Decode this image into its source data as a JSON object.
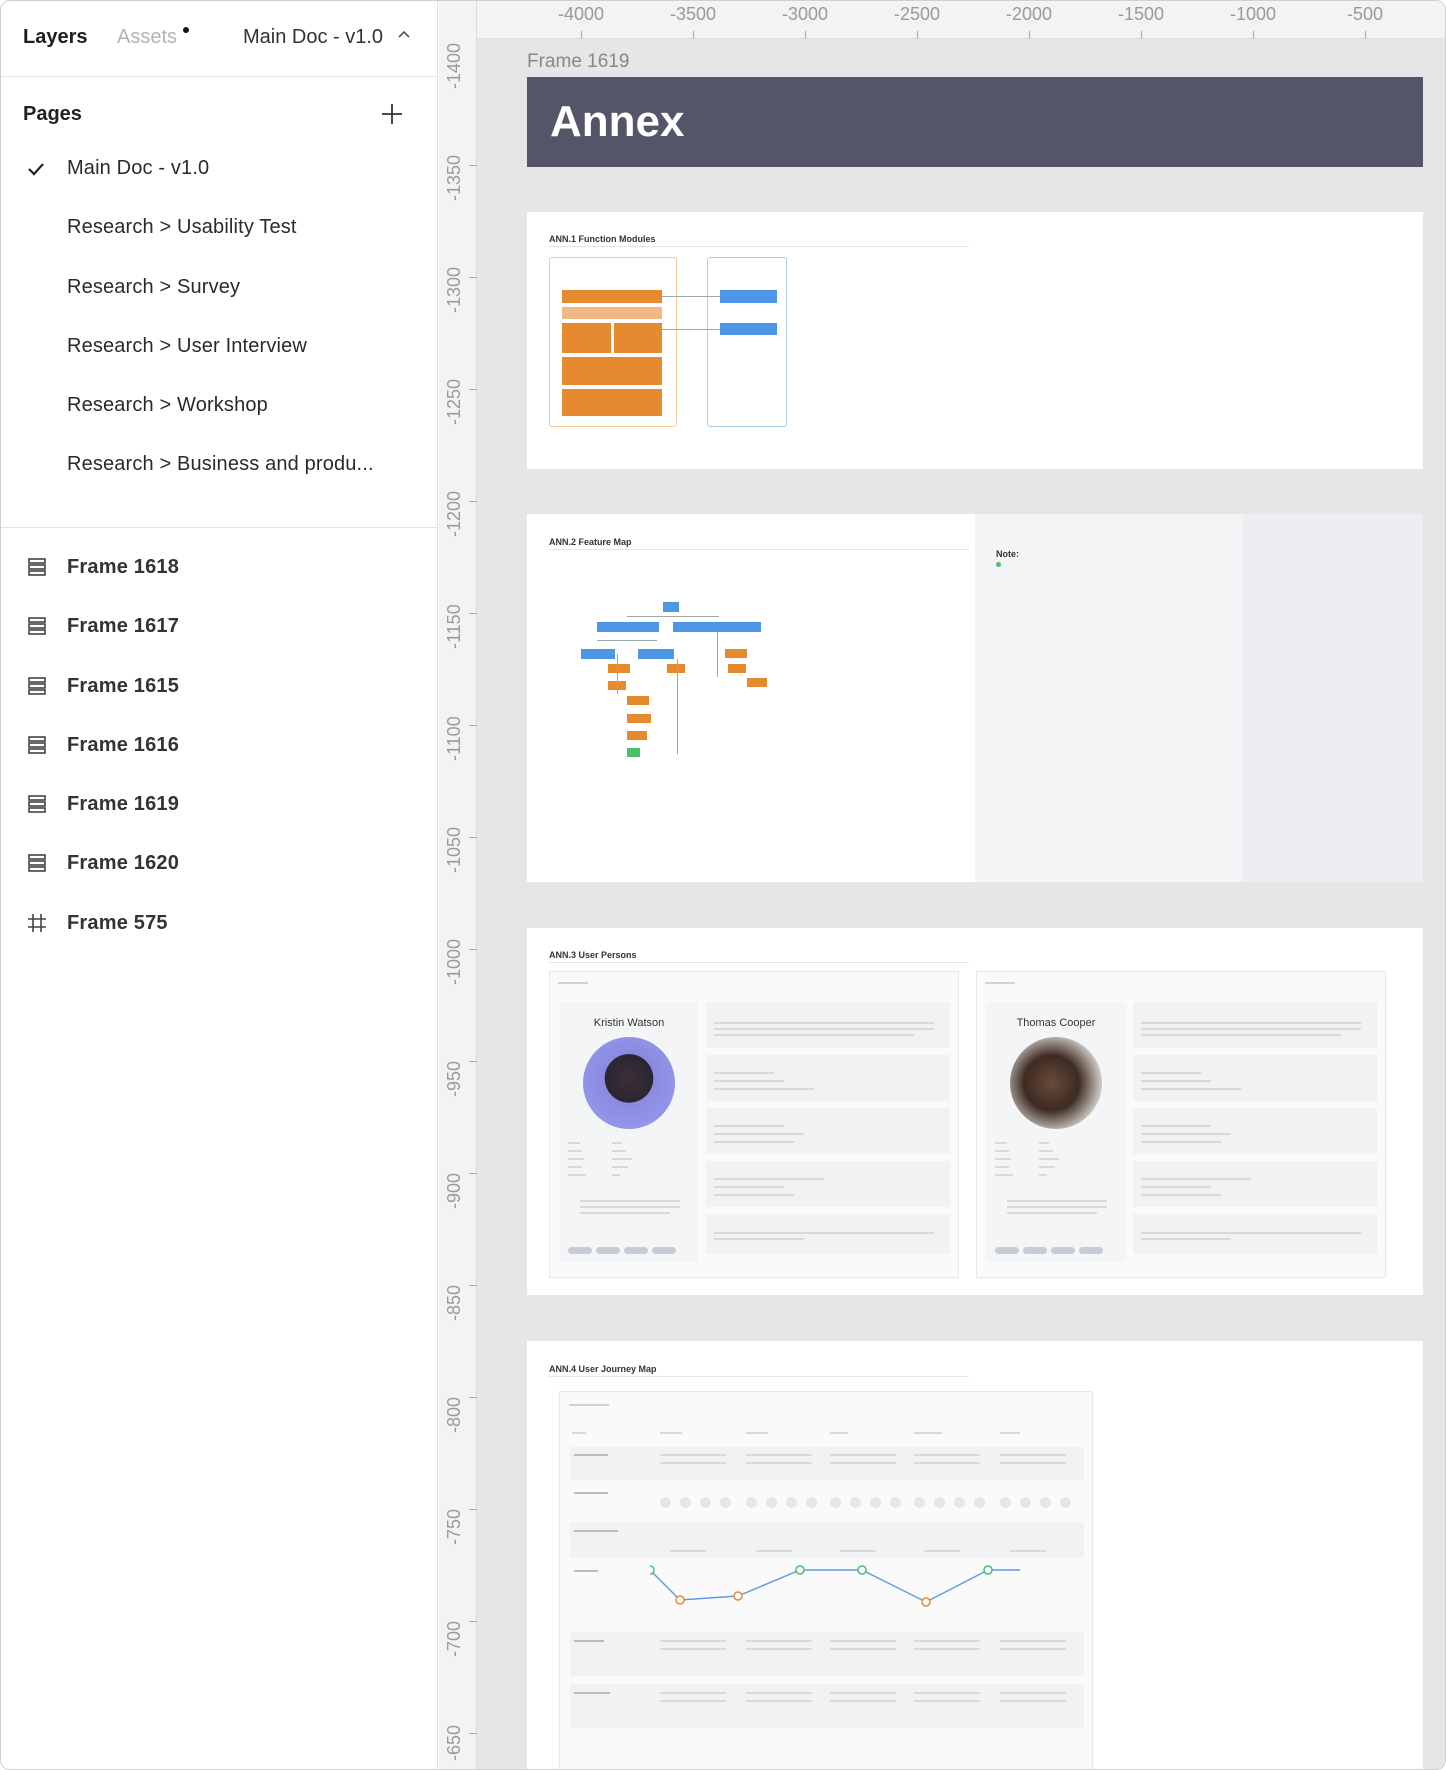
{
  "sidebar": {
    "tabs": {
      "layers": "Layers",
      "assets": "Assets"
    },
    "doc_name": "Main Doc - v1.0",
    "pages_title": "Pages",
    "pages": [
      {
        "label": "Main Doc - v1.0",
        "selected": true
      },
      {
        "label": "Research > Usability Test"
      },
      {
        "label": "Research > Survey"
      },
      {
        "label": "Research > User Interview"
      },
      {
        "label": "Research > Workshop"
      },
      {
        "label": "Research > Business and produ..."
      }
    ],
    "layers": [
      {
        "label": "Frame 1618",
        "icon": "frame-stack-icon"
      },
      {
        "label": "Frame 1617",
        "icon": "frame-stack-icon"
      },
      {
        "label": "Frame 1615",
        "icon": "frame-stack-icon"
      },
      {
        "label": "Frame 1616",
        "icon": "frame-stack-icon"
      },
      {
        "label": "Frame 1619",
        "icon": "frame-stack-icon"
      },
      {
        "label": "Frame 1620",
        "icon": "frame-stack-icon"
      },
      {
        "label": "Frame 575",
        "icon": "frame-grid-icon"
      }
    ]
  },
  "canvas": {
    "ruler_x": [
      "-4000",
      "-3500",
      "-3000",
      "-2500",
      "-2000",
      "-1500",
      "-1000",
      "-500"
    ],
    "ruler_y": [
      "-1400",
      "-1350",
      "-1300",
      "-1250",
      "-1200",
      "-1150",
      "-1100",
      "-1050",
      "-1000",
      "-950",
      "-900",
      "-850",
      "-800",
      "-750",
      "-700",
      "-650"
    ],
    "frame_label": "Frame 1619",
    "annex_title": "Annex",
    "sections": {
      "s1": "ANN.1 Function Modules",
      "s2": "ANN.2 Feature Map",
      "s3": "ANN.3 User Persons",
      "s4": "ANN.4 User Journey Map"
    },
    "note_label": "Note:",
    "personas": [
      "Kristin Watson",
      "Thomas Cooper"
    ]
  },
  "colors": {
    "annex_bg": "#555569",
    "orange": "#e58a2e",
    "blue": "#4d96e8",
    "green": "#49c06c"
  }
}
